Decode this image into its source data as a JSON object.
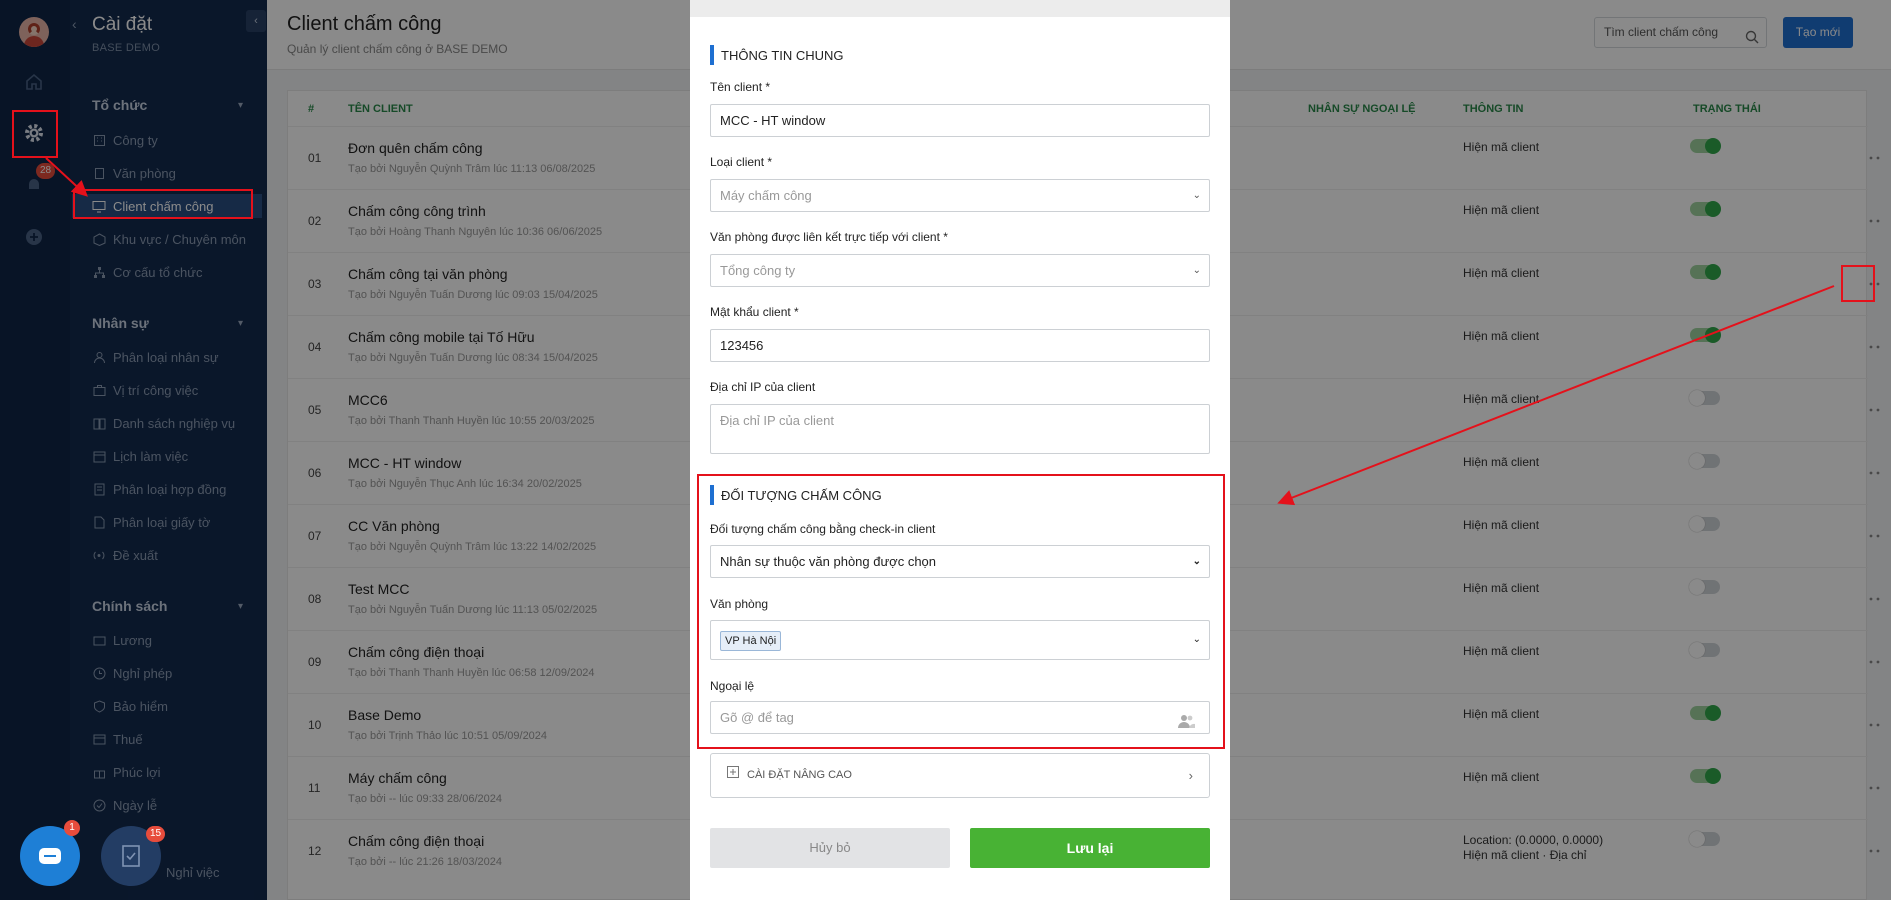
{
  "rail": {
    "bell_badge": "28",
    "task_badge": "15",
    "chat_badge": "1"
  },
  "sidebar": {
    "title": "Cài đặt",
    "subtitle": "BASE DEMO",
    "groups": [
      {
        "label": "Tổ chức",
        "items": [
          "Công ty",
          "Văn phòng",
          "Client chấm công",
          "Khu vực / Chuyên môn",
          "Cơ cấu tổ chức"
        ]
      },
      {
        "label": "Nhân sự",
        "items": [
          "Phân loại nhân sự",
          "Vị trí công việc",
          "Danh sách nghiệp vụ",
          "Lịch làm việc",
          "Phân loại hợp đồng",
          "Phân loại giấy tờ",
          "Đề xuất"
        ]
      },
      {
        "label": "Chính sách",
        "items": [
          "Lương",
          "Nghỉ phép",
          "Bảo hiểm",
          "Thuế",
          "Phúc lợi",
          "Ngày lễ",
          "Nghỉ việc"
        ]
      }
    ]
  },
  "header": {
    "title": "Client chấm công",
    "subtitle": "Quản lý client chấm công ở BASE DEMO",
    "search_placeholder": "Tìm client chấm công",
    "new_button": "Tạo mới"
  },
  "table": {
    "columns": {
      "index": "#",
      "name": "TÊN CLIENT",
      "exceptions": "NHÂN SỰ NGOẠI LỆ",
      "info": "THÔNG TIN",
      "status": "TRẠNG THÁI"
    },
    "rows": [
      {
        "idx": "01",
        "name": "Đơn quên chấm công",
        "by": "Tạo bởi Nguyễn Quỳnh Trâm lúc 11:13 06/08/2025",
        "info": "Hiện mã client",
        "info2": "",
        "on": true
      },
      {
        "idx": "02",
        "name": "Chấm công công trình",
        "by": "Tạo bởi Hoàng Thanh Nguyên lúc 10:36 06/06/2025",
        "info": "Hiện mã client",
        "info2": "",
        "on": true
      },
      {
        "idx": "03",
        "name": "Chấm công tại văn phòng",
        "by": "Tạo bởi Nguyễn Tuấn Dương lúc 09:03 15/04/2025",
        "info": "Hiện mã client",
        "info2": "",
        "on": true
      },
      {
        "idx": "04",
        "name": "Chấm công mobile tại Tố Hữu",
        "by": "Tạo bởi Nguyễn Tuấn Dương lúc 08:34 15/04/2025",
        "info": "Hiện mã client",
        "info2": "",
        "on": true
      },
      {
        "idx": "05",
        "name": "MCC6",
        "by": "Tạo bởi Thanh Thanh Huyền lúc 10:55 20/03/2025",
        "info": "Hiện mã client",
        "info2": "",
        "on": false
      },
      {
        "idx": "06",
        "name": "MCC - HT window",
        "by": "Tạo bởi Nguyễn Thục Anh lúc 16:34 20/02/2025",
        "info": "Hiện mã client",
        "info2": "",
        "on": false
      },
      {
        "idx": "07",
        "name": "CC Văn phòng",
        "by": "Tạo bởi Nguyễn Quỳnh Trâm lúc 13:22 14/02/2025",
        "info": "Hiện mã client",
        "info2": "",
        "on": false
      },
      {
        "idx": "08",
        "name": "Test MCC",
        "by": "Tạo bởi Nguyễn Tuấn Dương lúc 11:13 05/02/2025",
        "info": "Hiện mã client",
        "info2": "",
        "on": false
      },
      {
        "idx": "09",
        "name": "Chấm công điện thoại",
        "by": "Tạo bởi Thanh Thanh Huyền lúc 06:58 12/09/2024",
        "info": "Hiện mã client",
        "info2": "",
        "on": false
      },
      {
        "idx": "10",
        "name": "Base Demo",
        "by": "Tạo bởi Trịnh Thảo lúc 10:51 05/09/2024",
        "info": "Hiện mã client",
        "info2": "",
        "on": true
      },
      {
        "idx": "11",
        "name": "Máy chấm công",
        "by": "Tạo bởi -- lúc 09:33 28/06/2024",
        "info": "Hiện mã client",
        "info2": "",
        "on": true
      },
      {
        "idx": "12",
        "name": "Chấm công điện thoại",
        "by": "Tạo bởi -- lúc 21:26 18/03/2024",
        "info": "Location: (0.0000, 0.0000)",
        "info2": "Hiện mã client · Địa chỉ",
        "on": false
      }
    ]
  },
  "modal": {
    "general_title": "THÔNG TIN CHUNG",
    "client_name_label": "Tên client *",
    "client_name_value": "MCC - HT window",
    "client_type_label": "Loại client *",
    "client_type_value": "Máy chấm công",
    "office_label": "Văn phòng được liên kết trực tiếp với client *",
    "office_value": "Tổng công ty",
    "password_label": "Mật khẩu client *",
    "password_value": "123456",
    "ip_label": "Địa chỉ IP của client",
    "ip_placeholder": "Địa chỉ IP của client",
    "target_title": "ĐỐI TƯỢNG CHẤM CÔNG",
    "target_label": "Đối tượng chấm công bằng check-in client",
    "target_value": "Nhân sự thuộc văn phòng được chọn",
    "office2_label": "Văn phòng",
    "office2_tag": "VP Hà Nội",
    "exception_label": "Ngoại lệ",
    "exception_placeholder": "Gõ @ để tag",
    "advanced_label": "CÀI ĐẶT NÂNG CAO",
    "cancel_label": "Hủy bỏ",
    "save_label": "Lưu lại"
  }
}
